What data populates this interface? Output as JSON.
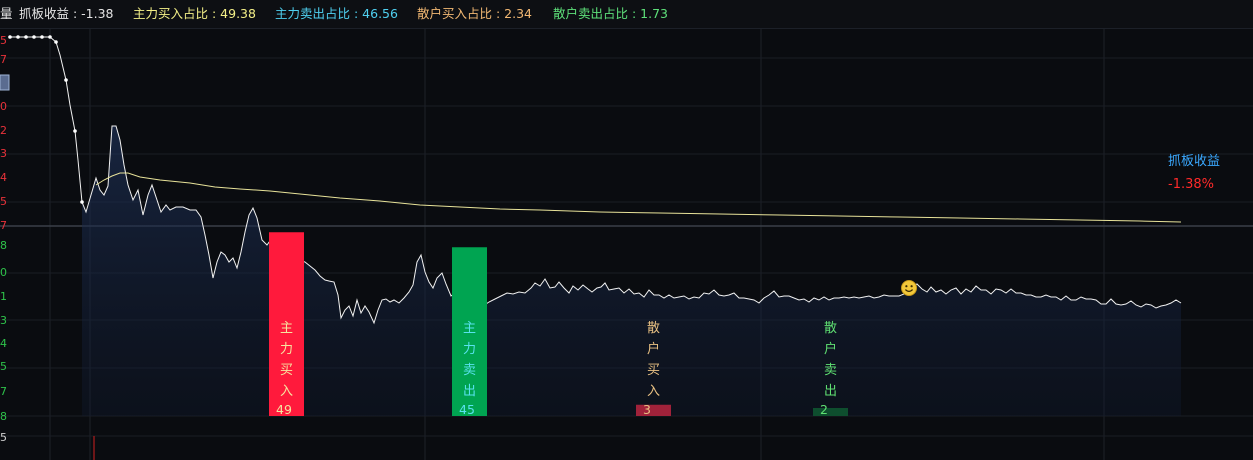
{
  "header": {
    "edge_glyph": "量",
    "items": [
      {
        "label": "抓板收益 : -1.38",
        "color": "#e4e4e4"
      },
      {
        "label": "主力买入占比 : 49.38",
        "color": "#f3ef87"
      },
      {
        "label": "主力卖出占比 : 46.56",
        "color": "#4fd0f0"
      },
      {
        "label": "散户买入占比 : 2.34",
        "color": "#f2b873"
      },
      {
        "label": "散户卖出占比 : 1.73",
        "color": "#5ee07a"
      }
    ]
  },
  "left_axis": {
    "upper_digits": [
      "5",
      "7",
      "",
      "0",
      "2",
      "3",
      "4",
      "5",
      "7"
    ],
    "upper_color": "#e8323a",
    "lower_digits": [
      "8",
      "0",
      "1",
      "3",
      "4",
      "5",
      "7",
      "8"
    ],
    "lower_color": "#2ec24a",
    "bottom_digit": "5",
    "bottom_color": "#cfcfcf"
  },
  "legend": {
    "title": "抓板收益",
    "title_color": "#3aa8ff",
    "value": "-1.38%",
    "value_color": "#ff2a2a"
  },
  "chart_data": {
    "type": "line",
    "series": [
      {
        "name": "抓板收益",
        "color": "#f2f2f2"
      },
      {
        "name": "",
        "color": "#e8e39a"
      }
    ],
    "bars": [
      {
        "label": "主力买入",
        "value": 49,
        "color": "#ff1a3c",
        "text_color": "#f6e5a0"
      },
      {
        "label": "主力卖出",
        "value": 45,
        "color": "#00a451",
        "text_color": "#59e2ee"
      },
      {
        "label": "散户买入",
        "value": 3,
        "color": "#a0223a",
        "text_color": "#e9c183"
      },
      {
        "label": "散户卖出",
        "value": 2,
        "color": "#0e4e2e",
        "text_color": "#5fe072"
      }
    ]
  }
}
